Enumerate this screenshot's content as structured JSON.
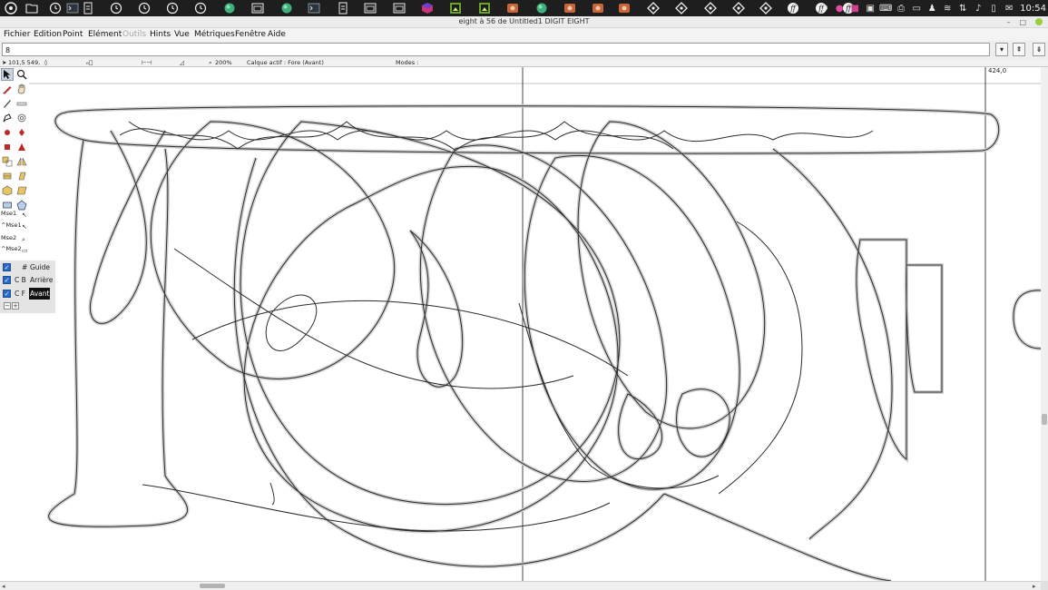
{
  "taskbar": {
    "launcher_icons": [
      "ubuntu-logo-icon",
      "folder-icon",
      "clock-icon",
      "terminal-icon",
      "document-icon",
      "clock-icon",
      "clock-icon",
      "clock-icon",
      "clock-icon",
      "globe-icon",
      "window-icon",
      "globe-icon",
      "terminal-icon",
      "document-icon",
      "window-icon",
      "window-icon",
      "cube-icon",
      "image-icon",
      "image-icon",
      "app-icon",
      "globe-icon",
      "app-icon",
      "app-icon",
      "app-icon",
      "diamond-icon",
      "diamond-icon",
      "diamond-icon",
      "diamond-icon",
      "diamond-icon",
      "fontforge-icon",
      "fontforge-icon",
      "fontforge-icon"
    ],
    "clock": "10:54"
  },
  "window": {
    "title": "eight à 56 de Untitled1 DIGIT EIGHT",
    "minimize": "–",
    "maximize": "□",
    "close": "×"
  },
  "menu": [
    {
      "label": "Fichier",
      "enabled": true
    },
    {
      "label": "Edition",
      "enabled": true
    },
    {
      "label": "Point",
      "enabled": true
    },
    {
      "label": "Elément",
      "enabled": true
    },
    {
      "label": "Outils",
      "enabled": false
    },
    {
      "label": "Hints",
      "enabled": true
    },
    {
      "label": "Vue",
      "enabled": true
    },
    {
      "label": "Métriques",
      "enabled": true
    },
    {
      "label": "Fenêtre",
      "enabled": true
    },
    {
      "label": "Aide",
      "enabled": true
    }
  ],
  "glyph_name_field": {
    "value": "8"
  },
  "status": {
    "coords": "101,5 549,",
    "zoom": "200%",
    "active_layer": "Calque actif : Fore (Avant)",
    "modes": "Modes :"
  },
  "toolbox": {
    "mouse_bindings": [
      "Mse1",
      "^Mse1",
      "Mse2",
      "^Mse2"
    ]
  },
  "layers": [
    {
      "code": "#",
      "name": "Guide",
      "checked": true,
      "selected": false
    },
    {
      "code": "C B",
      "name": "Arrière",
      "checked": true,
      "selected": false
    },
    {
      "code": "C F",
      "name": "Avant",
      "checked": true,
      "selected": true
    }
  ],
  "canvas": {
    "advance_width_label": "424,0"
  },
  "colors": {
    "taskbar_bg": "#1e1e1e",
    "outline_stroke": "#2b2b2b",
    "outline_halo": "#cfcfcf",
    "selected_layer_bg": "#111111",
    "checkbox_blue": "#2a68c8"
  }
}
